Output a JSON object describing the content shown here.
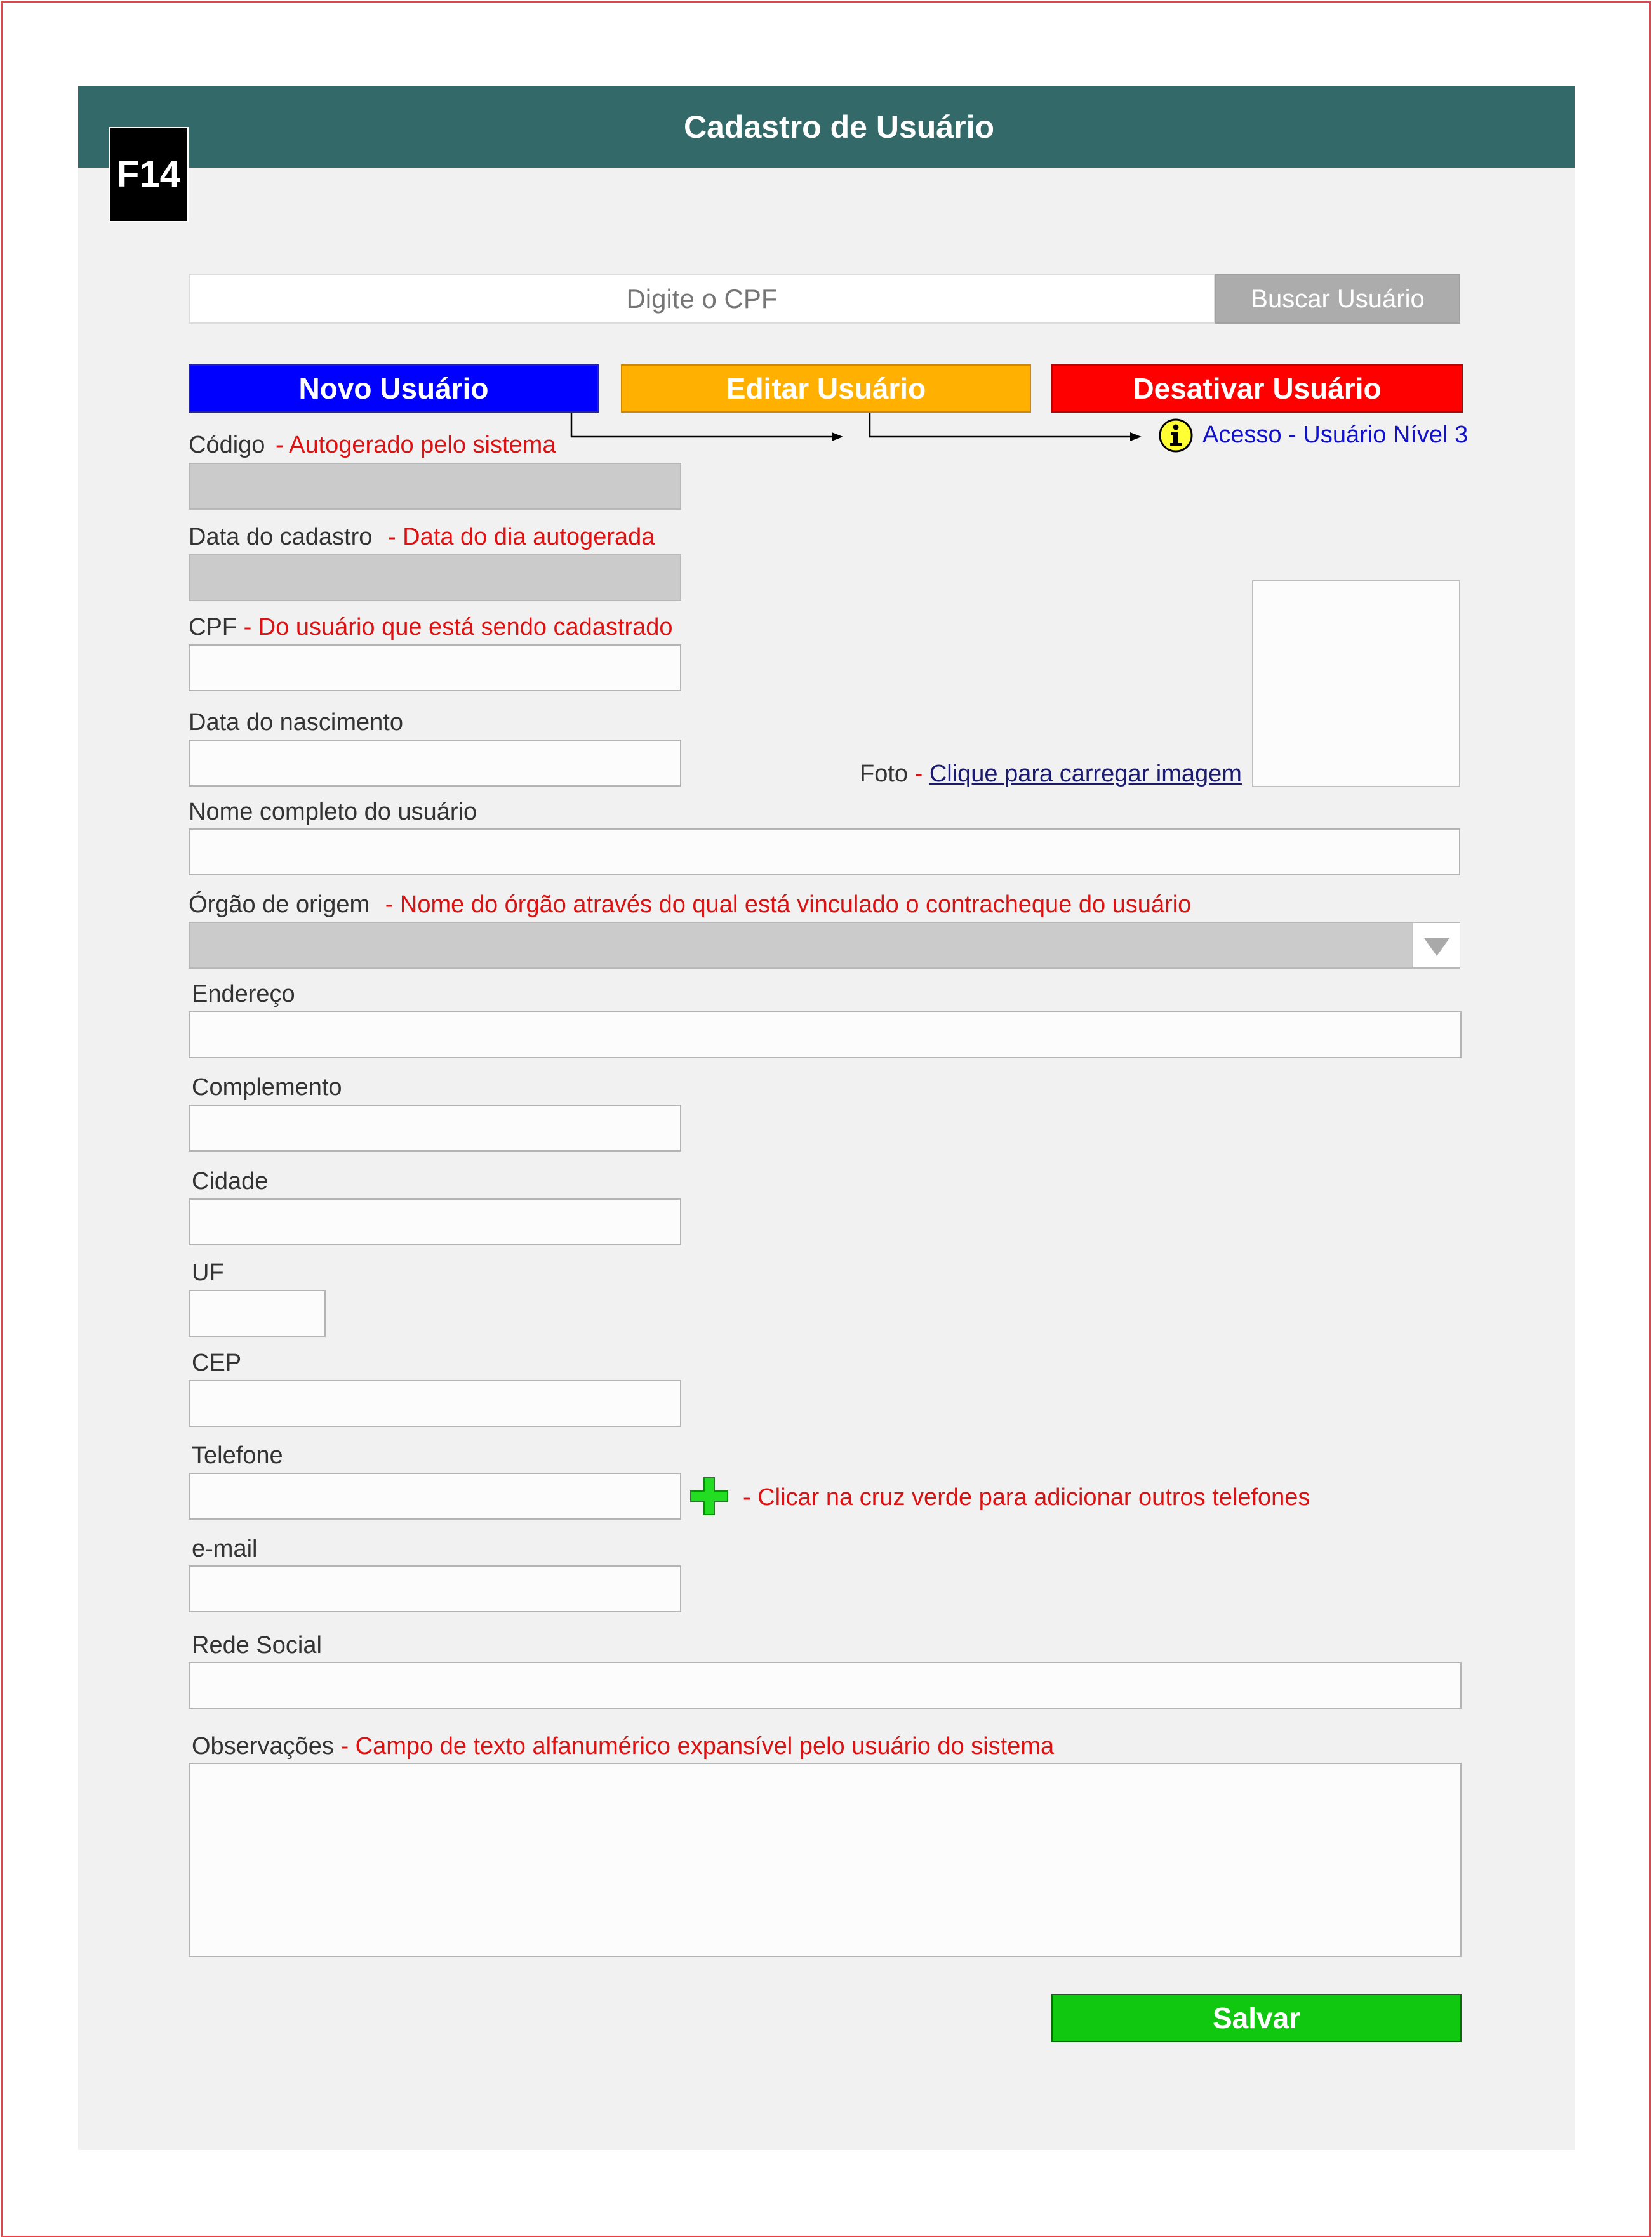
{
  "window": {
    "title": "Cadastro de Usuário",
    "badge": "F14"
  },
  "search": {
    "placeholder": "Digite o CPF",
    "button_label": "Buscar Usuário"
  },
  "actions": {
    "new_user": "Novo Usuário",
    "edit_user": "Editar Usuário",
    "deactivate_user": "Desativar Usuário",
    "access_note": "Acesso - Usuário Nível 3"
  },
  "form": {
    "codigo": {
      "label": "Código",
      "note": "- Autogerado pelo sistema"
    },
    "data_cadastro": {
      "label": "Data do cadastro",
      "note": "- Data do dia autogerada"
    },
    "cpf": {
      "label": "CPF",
      "note": "- Do usuário que está sendo cadastrado"
    },
    "data_nascimento": {
      "label": "Data do nascimento"
    },
    "foto": {
      "label": "Foto",
      "dash": "-",
      "link": "Clique para carregar imagem"
    },
    "nome": {
      "label": "Nome completo do usuário"
    },
    "orgao": {
      "label": "Órgão de origem",
      "note": "- Nome do órgão através do qual está vinculado o contracheque do usuário"
    },
    "endereco": {
      "label": "Endereço"
    },
    "complemento": {
      "label": "Complemento"
    },
    "cidade": {
      "label": "Cidade"
    },
    "uf": {
      "label": "UF"
    },
    "cep": {
      "label": "CEP"
    },
    "telefone": {
      "label": "Telefone",
      "note": "- Clicar na cruz verde para adicionar outros telefones"
    },
    "email": {
      "label": "e-mail"
    },
    "rede_social": {
      "label": "Rede Social"
    },
    "observacoes": {
      "label": "Observações",
      "note": "- Campo de texto alfanumérico expansível pelo usuário do sistema"
    }
  },
  "save_label": "Salvar",
  "colors": {
    "header": "#336969",
    "new_user": "#0000ff",
    "edit_user": "#ffb000",
    "deactivate_user": "#ff0000",
    "save": "#11c811",
    "notes": "#dd1111",
    "access_note": "#1111cc"
  },
  "icons": {
    "info": "info-icon",
    "add_phone": "plus-icon",
    "dropdown": "chevron-down-icon"
  }
}
